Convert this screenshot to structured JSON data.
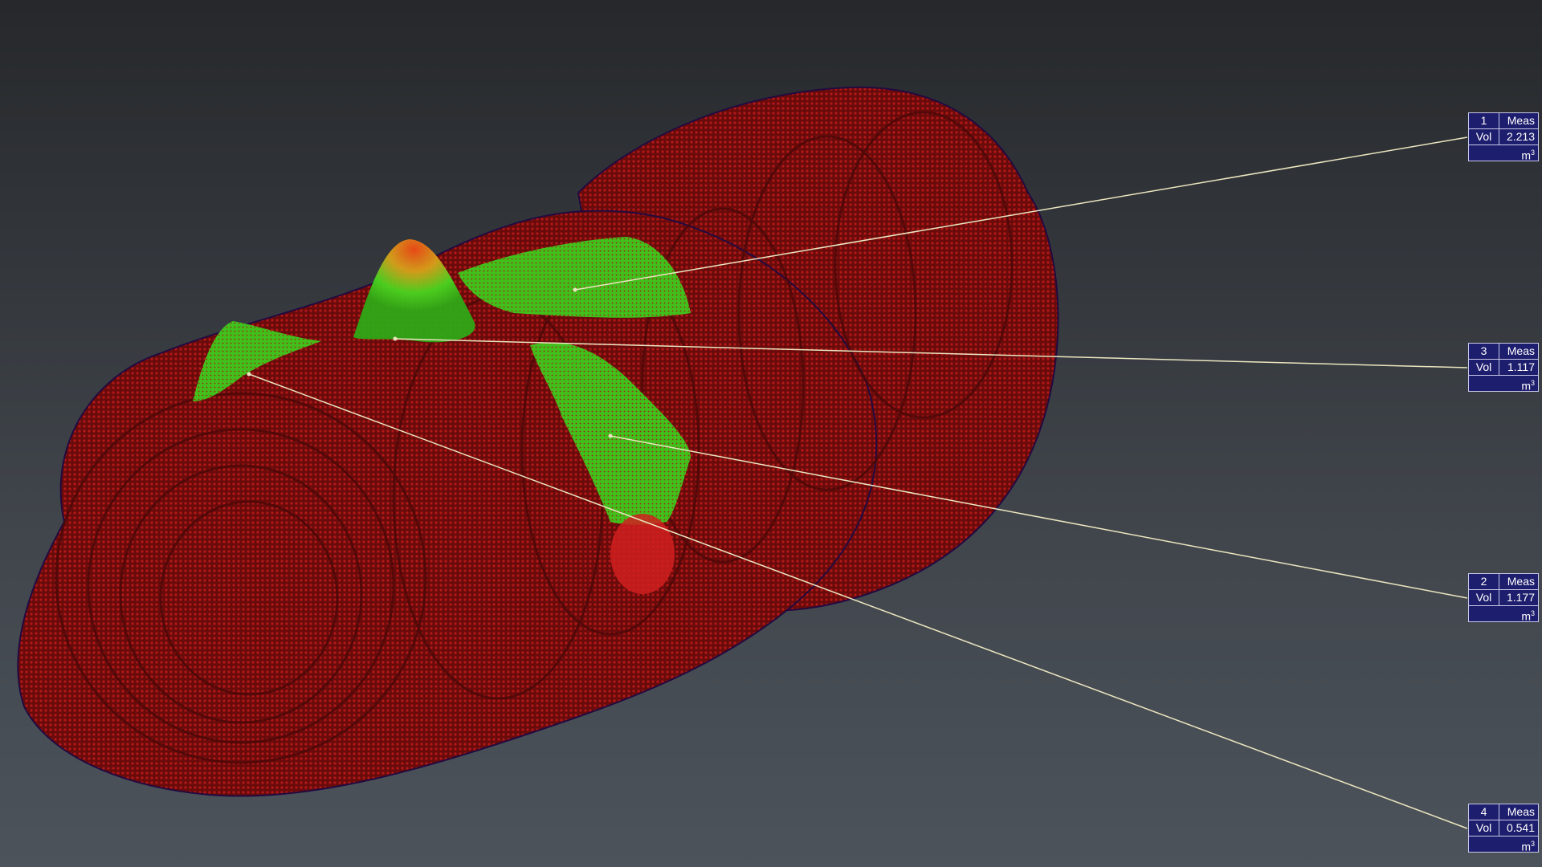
{
  "viewport": {
    "background_top": "#26282b",
    "background_bottom": "#4c535b",
    "object_color": "#7a0d0d",
    "highlight_green": "#3ed21a",
    "highlight_red": "#e83a1a",
    "leader_line_color": "#ece6c0",
    "label_bg_color": "#1e1e6e"
  },
  "measurements": [
    {
      "id": "1",
      "kind": "Meas",
      "quantity": "Vol",
      "value": "2.213",
      "unit": "m",
      "unit_exp": "3"
    },
    {
      "id": "3",
      "kind": "Meas",
      "quantity": "Vol",
      "value": "1.117",
      "unit": "m",
      "unit_exp": "3"
    },
    {
      "id": "2",
      "kind": "Meas",
      "quantity": "Vol",
      "value": "1.177",
      "unit": "m",
      "unit_exp": "3"
    },
    {
      "id": "4",
      "kind": "Meas",
      "quantity": "Vol",
      "value": "0.541",
      "unit": "m",
      "unit_exp": "3"
    }
  ]
}
